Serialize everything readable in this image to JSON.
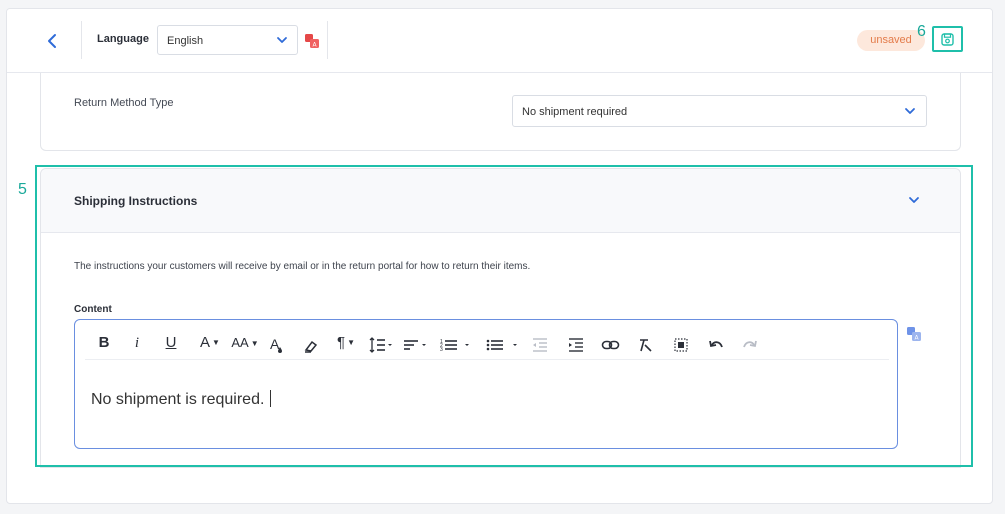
{
  "header": {
    "language_label": "Language",
    "language_value": "English",
    "status_badge": "unsaved",
    "step_marker": "6"
  },
  "return_method": {
    "label": "Return Method Type",
    "value": "No shipment required"
  },
  "shipping_instructions": {
    "step_marker": "5",
    "title": "Shipping Instructions",
    "description": "The instructions your customers will receive by email or in the return portal for how to return their items.",
    "content_label": "Content",
    "content_text": "No shipment is required."
  },
  "toolbar": {
    "bold": "B",
    "italic": "i",
    "underline": "U",
    "font_color": "A",
    "font_size": "AA",
    "paragraph": "¶"
  },
  "colors": {
    "accent_blue": "#2f6bd8",
    "highlight_teal": "#1fbfaa",
    "badge_bg": "#fde8dc",
    "badge_text": "#e37b4a"
  },
  "icons": {
    "back": "chevron-left-icon",
    "translate": "translate-icon",
    "save": "save-icon",
    "expand": "chevron-down-icon"
  }
}
